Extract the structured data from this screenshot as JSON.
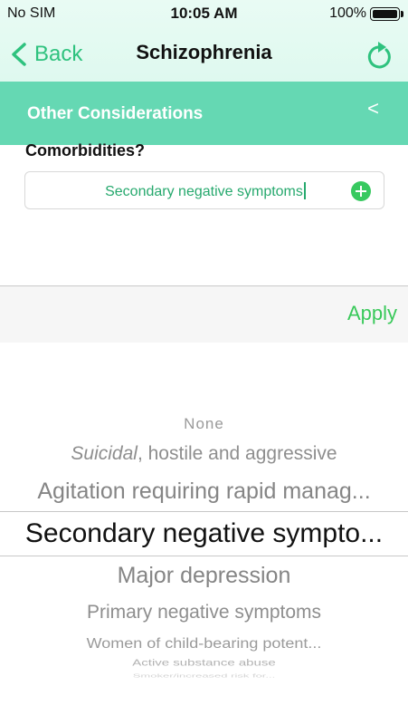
{
  "status_bar": {
    "carrier": "No SIM",
    "time": "10:05 AM",
    "battery": "100%"
  },
  "nav": {
    "back_label": "Back",
    "title": "Schizophrenia"
  },
  "section": {
    "title": "Other Considerations",
    "collapse_label": "<"
  },
  "form": {
    "question": "Comorbidities?",
    "field_value": "Secondary negative symptoms"
  },
  "toolbar": {
    "apply_label": "Apply"
  },
  "picker": {
    "options": [
      "None",
      "Suicidal, hostile and aggressive",
      "Agitation requiring rapid manag...",
      "Secondary negative sympto...",
      "Major depression",
      "Primary negative symptoms",
      "Women of child-bearing potent...",
      "Active substance abuse",
      "Smoker/increased risk for..."
    ],
    "selected_index": 3
  },
  "colors": {
    "accent": "#2ec27e",
    "section_bar": "#65d8b3",
    "apply": "#39c95a"
  }
}
